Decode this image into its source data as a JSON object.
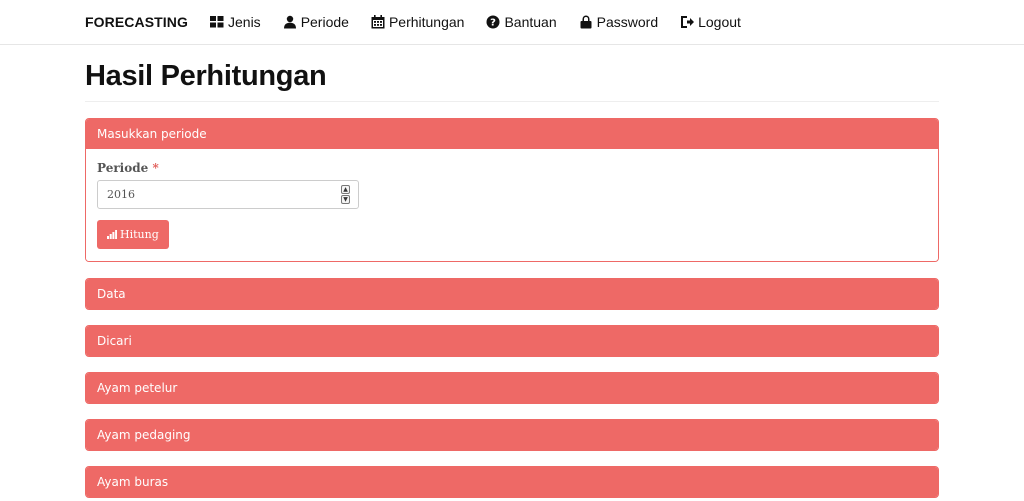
{
  "navbar": {
    "brand": "FORECASTING",
    "items": [
      {
        "label": "Jenis",
        "icon": "grid-icon"
      },
      {
        "label": "Periode",
        "icon": "user-icon"
      },
      {
        "label": "Perhitungan",
        "icon": "calendar-icon"
      },
      {
        "label": "Bantuan",
        "icon": "question-circle-icon"
      },
      {
        "label": "Password",
        "icon": "lock-icon"
      },
      {
        "label": "Logout",
        "icon": "logout-icon"
      }
    ]
  },
  "page": {
    "title": "Hasil Perhitungan"
  },
  "form_panel": {
    "heading": "Masukkan periode",
    "field_label": "Periode",
    "required_mark": "*",
    "periode_value": "2016",
    "button_label": "Hitung",
    "button_icon": "signal-bars-icon"
  },
  "panels": [
    {
      "heading": "Data"
    },
    {
      "heading": "Dicari"
    },
    {
      "heading": "Ayam petelur"
    },
    {
      "heading": "Ayam pedaging"
    },
    {
      "heading": "Ayam buras"
    }
  ],
  "colors": {
    "accent": "#ee6966",
    "text": "#111111"
  }
}
